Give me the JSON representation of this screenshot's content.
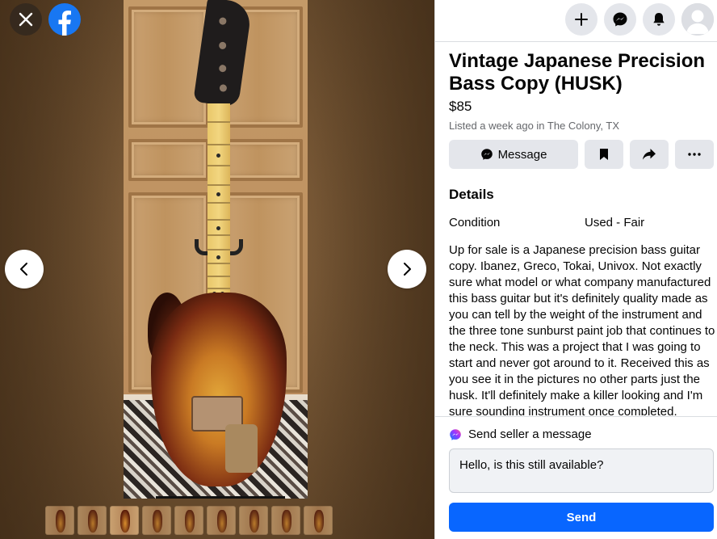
{
  "viewer": {
    "thumbnail_count": 9,
    "active_thumbnail_index": 2
  },
  "listing": {
    "title": "Vintage Japanese Precision Bass Copy (HUSK)",
    "price": "$85",
    "listed": "Listed a week ago in The Colony, TX",
    "message_label": "Message",
    "details_heading": "Details",
    "condition_label": "Condition",
    "condition_value": "Used - Fair",
    "description": "Up for sale is a Japanese precision bass guitar copy. Ibanez, Greco, Tokai, Univox. Not exactly sure what model or what company manufactured this bass guitar but it's definitely quality made as you can tell by the weight of the instrument and the three tone sunburst paint job that continues to the neck. This was a project that I was going to start and never got around to it. Received this as you see it in the pictures no other parts just the husk. It'll definitely make a killer looking and I'm sure sounding instrument once completed."
  },
  "compose": {
    "heading": "Send seller a message",
    "message": "Hello, is this still available?",
    "send_label": "Send"
  },
  "icons": {
    "close": "close-icon",
    "facebook": "facebook-logo-icon",
    "prev": "chevron-left-icon",
    "next": "chevron-right-icon",
    "create": "plus-icon",
    "messenger": "messenger-icon",
    "notifications": "bell-icon",
    "save": "bookmark-icon",
    "share": "share-icon",
    "more": "more-icon"
  },
  "colors": {
    "primary": "#0866ff",
    "facebook": "#1877f2",
    "button_bg": "#e4e6eb",
    "secondary_text": "#65676b"
  }
}
